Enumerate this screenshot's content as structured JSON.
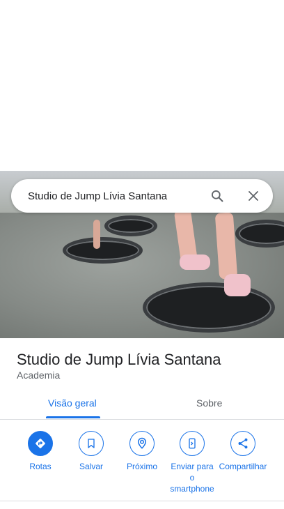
{
  "search": {
    "query": "Studio de Jump Lívia Santana"
  },
  "place": {
    "name": "Studio de Jump Lívia Santana",
    "category": "Academia"
  },
  "tabs": [
    {
      "label": "Visão geral",
      "active": true
    },
    {
      "label": "Sobre",
      "active": false
    }
  ],
  "actions": [
    {
      "label": "Rotas",
      "icon": "directions-icon"
    },
    {
      "label": "Salvar",
      "icon": "bookmark-icon"
    },
    {
      "label": "Próximo",
      "icon": "nearby-icon"
    },
    {
      "label": "Enviar para o smartphone",
      "icon": "send-to-phone-icon"
    },
    {
      "label": "Compartilhar",
      "icon": "share-icon"
    }
  ],
  "colors": {
    "accent": "#1a73e8",
    "text_primary": "#202124",
    "text_secondary": "#5f6368",
    "divider": "#dadce0"
  }
}
